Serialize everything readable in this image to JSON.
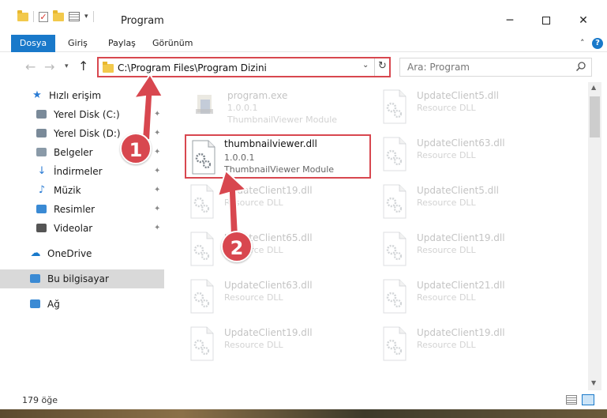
{
  "window": {
    "title": "Program",
    "minimize_label": "─",
    "close_label": "✕"
  },
  "ribbon": {
    "tabs": [
      "Dosya",
      "Giriş",
      "Paylaş",
      "Görünüm"
    ],
    "help_label": "?",
    "collapse_label": "˄"
  },
  "nav": {
    "back_label": "←",
    "forward_label": "→",
    "recent_label": "▾",
    "up_label": "↑",
    "address": "C:\\Program Files\\Program Dizini",
    "address_dropdown": "⌄",
    "refresh_label": "↻",
    "search_placeholder": "Ara: Program"
  },
  "pane": {
    "items": [
      {
        "label": "Hızlı erişim",
        "icon": "star-icon",
        "pinned": false
      },
      {
        "label": "Yerel Disk (C:)",
        "icon": "drive-icon",
        "pinned": true
      },
      {
        "label": "Yerel Disk (D:)",
        "icon": "drive-icon",
        "pinned": true
      },
      {
        "label": "Belgeler",
        "icon": "documents-icon",
        "pinned": true
      },
      {
        "label": "İndirmeler",
        "icon": "download-icon",
        "pinned": true
      },
      {
        "label": "Müzik",
        "icon": "music-icon",
        "pinned": true
      },
      {
        "label": "Resimler",
        "icon": "pictures-icon",
        "pinned": true
      },
      {
        "label": "Videolar",
        "icon": "videos-icon",
        "pinned": true
      },
      {
        "label": "OneDrive",
        "icon": "cloud-icon",
        "pinned": false
      },
      {
        "label": "Bu bilgisayar",
        "icon": "computer-icon",
        "pinned": false,
        "selected": true
      },
      {
        "label": "Ağ",
        "icon": "network-icon",
        "pinned": false
      }
    ],
    "pin_glyph": "📌"
  },
  "files": {
    "left_column": [
      {
        "name": "program.exe",
        "line1": "1.0.0.1",
        "line2": "ThumbnailViewer Module"
      },
      {
        "name": "thumbnailviewer.dll",
        "line1": "1.0.0.1",
        "line2": "ThumbnailViewer Module",
        "highlighted": true
      },
      {
        "name": "UpdateClient19.dll",
        "line1": "Resource DLL",
        "line2": ""
      },
      {
        "name": "UpdateClient65.dll",
        "line1": "Resource DLL",
        "line2": ""
      },
      {
        "name": "UpdateClient63.dll",
        "line1": "Resource DLL",
        "line2": ""
      },
      {
        "name": "UpdateClient19.dll",
        "line1": "Resource DLL",
        "line2": ""
      }
    ],
    "right_column": [
      {
        "name": "UpdateClient5.dll",
        "line1": "Resource DLL"
      },
      {
        "name": "UpdateClient63.dll",
        "line1": "Resource DLL"
      },
      {
        "name": "UpdateClient5.dll",
        "line1": "Resource DLL"
      },
      {
        "name": "UpdateClient19.dll",
        "line1": "Resource DLL"
      },
      {
        "name": "UpdateClient21.dll",
        "line1": "Resource DLL"
      },
      {
        "name": "UpdateClient19.dll",
        "line1": "Resource DLL"
      }
    ]
  },
  "status": {
    "count": "179 öğe"
  },
  "callouts": {
    "step1": "1",
    "step2": "2",
    "color": "#d8474f"
  }
}
